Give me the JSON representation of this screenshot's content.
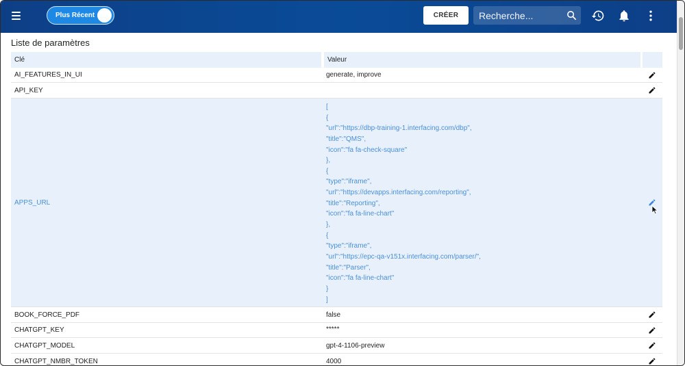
{
  "topbar": {
    "menu_icon": "hamburger-menu-icon",
    "toggle_label": "Plus Récent",
    "create_label": "CRÉER",
    "search_placeholder": "Recherche...",
    "icons": [
      "search-icon",
      "history-icon",
      "bell-icon",
      "more-vert-icon"
    ]
  },
  "section_title": "Liste de paramètres",
  "table": {
    "headers": {
      "key": "Clé",
      "value": "Valeur"
    },
    "rows": [
      {
        "key": "AI_FEATURES_IN_UI",
        "value": "generate, improve"
      },
      {
        "key": "API_KEY",
        "value": ""
      },
      {
        "key": "APPS_URL",
        "value_lines": [
          "[",
          " {",
          "\"url\":\"https://dbp-training-1.interfacing.com/dbp\",",
          "\"title\":\"QMS\",",
          "\"icon\":\"fa fa-check-square\"",
          "},",
          "{",
          "\"type\":\"iframe\",",
          "\"url\":\"https://devapps.interfacing.com/reporting\",",
          "\"title\":\"Reporting\",",
          "\"icon\":\"fa fa-line-chart\"",
          "},",
          "{",
          "\"type\":\"iframe\",",
          "\"url\":\"https://epc-qa-v151x.interfacing.com/parser/\",",
          "\"title\":\"Parser\",",
          "\"icon\":\"fa fa-line-chart\"",
          "}",
          "]"
        ]
      },
      {
        "key": "BOOK_FORCE_PDF",
        "value": "false"
      },
      {
        "key": "CHATGPT_KEY",
        "value": "*****"
      },
      {
        "key": "CHATGPT_MODEL",
        "value": "gpt-4-1106-preview"
      },
      {
        "key": "CHATGPT_NMBR_TOKEN",
        "value": "4000"
      }
    ]
  },
  "colors": {
    "topbar": "#0d3f86",
    "toggle": "#1e88e5",
    "header_row": "#e8f1fb",
    "selected_row": "#e8f1fb",
    "selected_text": "#4a8fd6"
  }
}
